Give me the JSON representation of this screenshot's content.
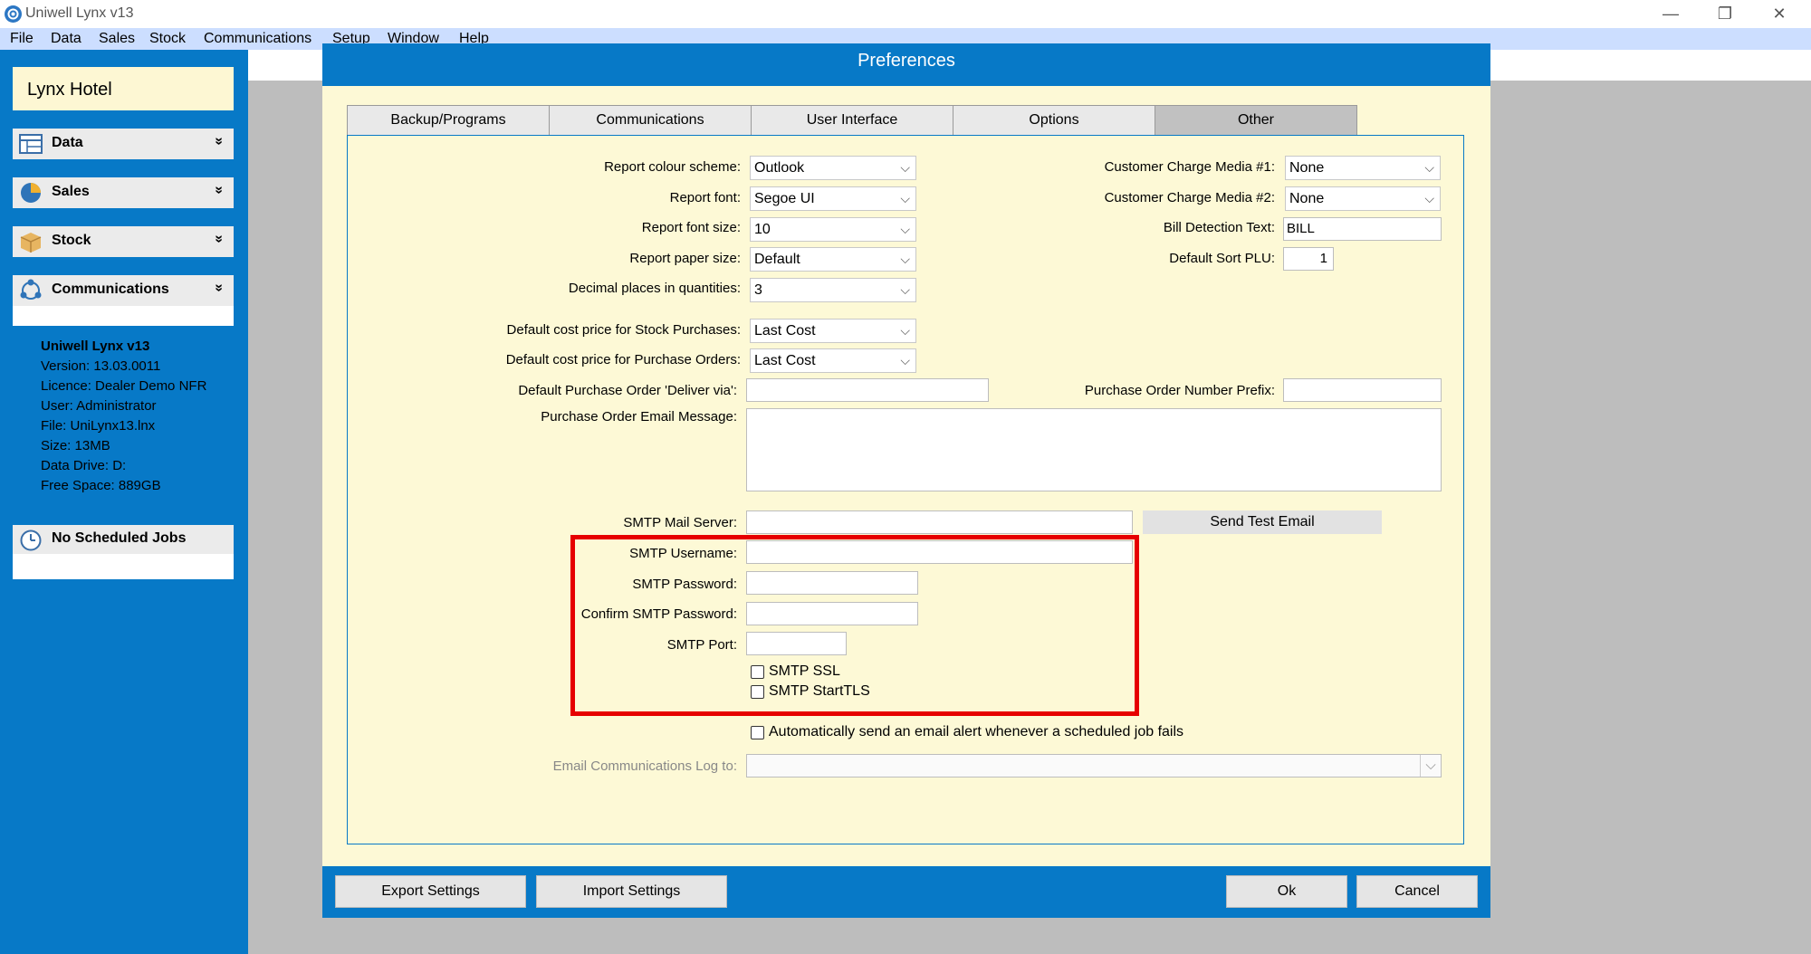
{
  "app": {
    "title": "Uniwell Lynx v13",
    "minimize": "—",
    "restore": "❐",
    "close": "✕"
  },
  "menu": [
    "File",
    "Data",
    "Sales",
    "Stock",
    "Communications",
    "Setup",
    "Window",
    "Help"
  ],
  "sidebar": {
    "title": "Lynx Hotel",
    "items": [
      {
        "label": "Data",
        "icon": "data-table-icon",
        "chevron": "»"
      },
      {
        "label": "Sales",
        "icon": "pie-chart-icon",
        "chevron": "»"
      },
      {
        "label": "Stock",
        "icon": "box-icon",
        "chevron": "»"
      },
      {
        "label": "Communications",
        "icon": "network-icon",
        "chevron": "»"
      }
    ],
    "info": {
      "product": "Uniwell Lynx v13",
      "version": "Version: 13.03.0011",
      "licence": "Licence: Dealer Demo NFR",
      "user": "User: Administrator",
      "file": "File: UniLynx13.lnx",
      "size": "Size: 13MB",
      "drive": "Data Drive: D:",
      "free": "Free Space: 889GB"
    },
    "jobs": "No Scheduled Jobs"
  },
  "dialog": {
    "title": "Preferences",
    "tabs": [
      {
        "label": "Backup/Programs",
        "active": false
      },
      {
        "label": "Communications",
        "active": false
      },
      {
        "label": "User Interface",
        "active": false
      },
      {
        "label": "Options",
        "active": false
      },
      {
        "label": "Other",
        "active": true
      }
    ],
    "fields": {
      "report_colour_scheme": {
        "label": "Report colour scheme:",
        "value": "Outlook"
      },
      "report_font": {
        "label": "Report font:",
        "value": "Segoe UI"
      },
      "report_font_size": {
        "label": "Report font size:",
        "value": "10"
      },
      "report_paper_size": {
        "label": "Report paper size:",
        "value": "Default"
      },
      "decimal_places": {
        "label": "Decimal places in quantities:",
        "value": "3"
      },
      "cost_stock_purchases": {
        "label": "Default cost price for Stock Purchases:",
        "value": "Last Cost"
      },
      "cost_purchase_orders": {
        "label": "Default cost price for Purchase Orders:",
        "value": "Last Cost"
      },
      "po_deliver_via": {
        "label": "Default Purchase Order 'Deliver via':",
        "value": ""
      },
      "po_email_message": {
        "label": "Purchase Order Email Message:",
        "value": ""
      },
      "charge_media_1": {
        "label": "Customer Charge Media #1:",
        "value": "None"
      },
      "charge_media_2": {
        "label": "Customer Charge Media #2:",
        "value": "None"
      },
      "bill_detection": {
        "label": "Bill Detection Text:",
        "value": "BILL"
      },
      "default_sort_plu": {
        "label": "Default Sort PLU:",
        "value": "1"
      },
      "po_number_prefix": {
        "label": "Purchase Order Number Prefix:",
        "value": ""
      },
      "smtp_server": {
        "label": "SMTP Mail Server:",
        "value": ""
      },
      "smtp_username": {
        "label": "SMTP Username:",
        "value": ""
      },
      "smtp_password": {
        "label": "SMTP Password:",
        "value": ""
      },
      "smtp_confirm": {
        "label": "Confirm SMTP Password:",
        "value": ""
      },
      "smtp_port": {
        "label": "SMTP Port:",
        "value": ""
      },
      "email_log": {
        "label": "Email Communications Log to:",
        "value": ""
      }
    },
    "checkboxes": {
      "smtp_ssl": {
        "label": "SMTP SSL",
        "checked": false
      },
      "smtp_starttls": {
        "label": "SMTP StartTLS",
        "checked": false
      },
      "auto_alert": {
        "label": "Automatically send an email alert whenever a scheduled job fails",
        "checked": false
      }
    },
    "send_test_email": "Send Test Email",
    "footer": {
      "export": "Export Settings",
      "import": "Import Settings",
      "ok": "Ok",
      "cancel": "Cancel"
    }
  },
  "colors": {
    "brand_blue": "#0779c7",
    "panel_cream": "#fdf9d6",
    "highlight_red": "#e60000"
  }
}
